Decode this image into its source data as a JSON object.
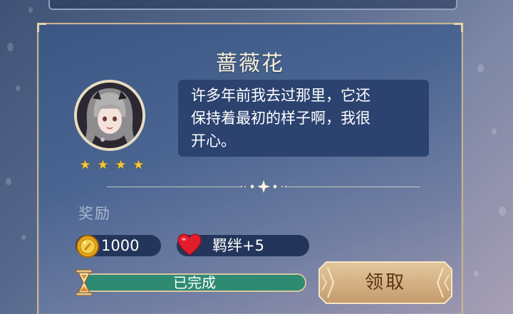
{
  "quest": {
    "character_name": "蔷薇花",
    "rating_stars": 4,
    "dialogue": "许多年前我去过那里，它还保持着最初的样子啊，我很开心。",
    "dialogue_lines": [
      "许多年前我去过那里，它还",
      "保持着最初的样子啊，我很",
      "开心。"
    ]
  },
  "rewards": {
    "label": "奖励",
    "coin": {
      "icon": "gold-coin-icon",
      "amount": "1000"
    },
    "bond": {
      "icon": "heart-icon",
      "text": "羁绊+5"
    }
  },
  "progress": {
    "icon": "hourglass-icon",
    "status_text": "已完成",
    "fraction": 1.0
  },
  "actions": {
    "claim_label": "领取"
  },
  "colors": {
    "panel_border": "#c7b38a",
    "dialog_bg": "#2c4370",
    "progress_fill": "#2f8a72",
    "claim_button": "#c9a77c",
    "star": "#f3c93c"
  }
}
